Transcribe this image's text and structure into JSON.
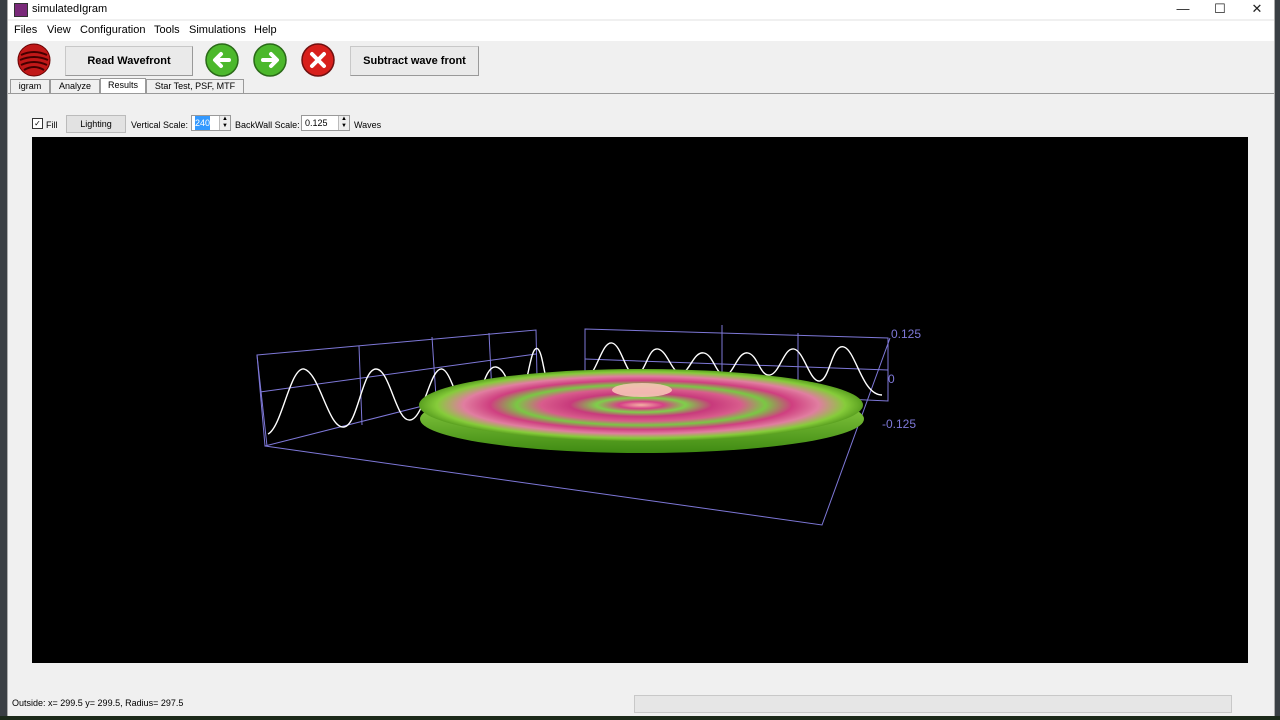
{
  "window": {
    "title": "simulatedIgram",
    "minimize": "—",
    "maximize": "☐",
    "close": "✕"
  },
  "menu": [
    "Files",
    "View",
    "Configuration",
    "Tools",
    "Simulations",
    "Help"
  ],
  "toolbar": {
    "read_label": "Read Wavefront",
    "subtract_label": "Subtract wave front"
  },
  "tabs": [
    "igram",
    "Analyze",
    "Results",
    "Star Test, PSF, MTF"
  ],
  "options": {
    "fill_checked": "✓",
    "fill_label": "Fill",
    "lighting_label": "Lighting",
    "vertical_scale_label": "Vertical Scale:",
    "vertical_scale_value": "240",
    "backwall_scale_label": "BackWall Scale:",
    "backwall_scale_value": "0.125",
    "units_label": "Waves"
  },
  "plot": {
    "axis_labels": [
      "0.125",
      "0",
      "-0.125"
    ],
    "colors": {
      "grid": "#8a84e0",
      "axis_text": "#8a84e0",
      "trace": "#ffffff",
      "surface_green": "#6ec832",
      "surface_pink": "#d0387a"
    }
  },
  "status": {
    "text": "Outside: x= 299.5 y= 299.5, Radius=  297.5"
  }
}
